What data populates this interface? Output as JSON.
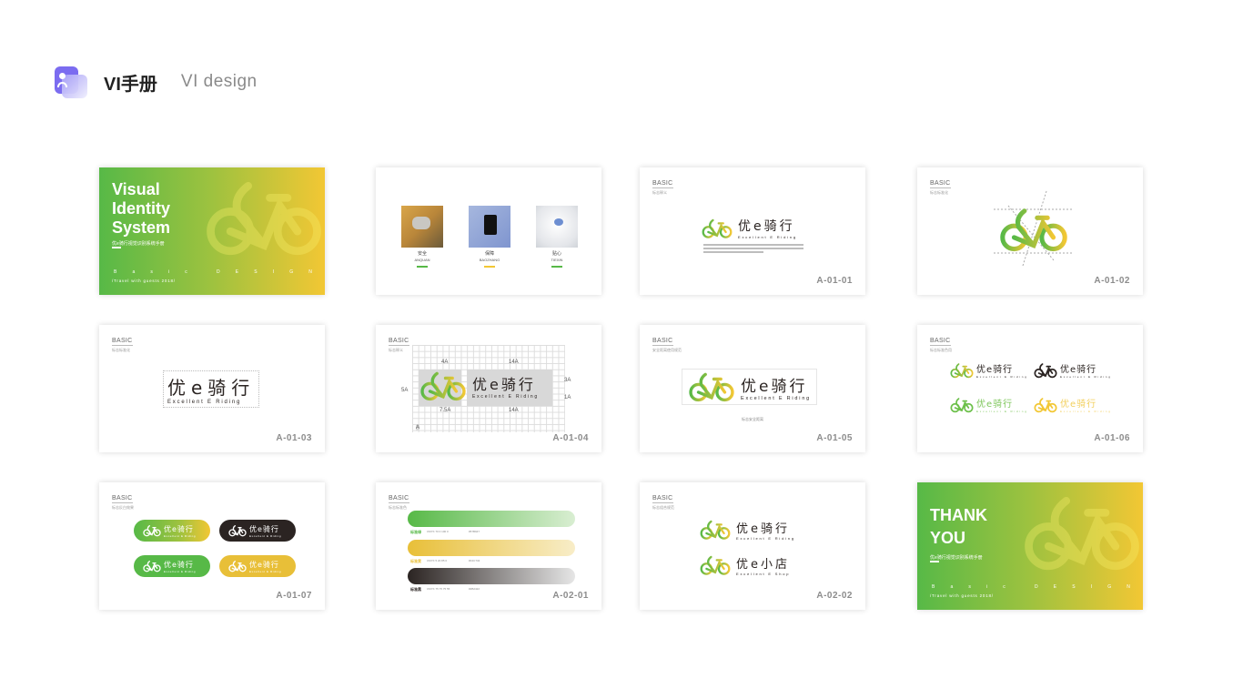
{
  "header": {
    "title": "VI手册",
    "subtitle": "VI design"
  },
  "brand": {
    "name_cn": "优e骑行",
    "name_en": "Excellent E Riding",
    "shop_cn": "优e小店",
    "shop_en": "Excellent E Shop",
    "colors": {
      "green": "#57b947",
      "yellow": "#f2c734",
      "dark": "#2b2422",
      "light_green": "#7dc65a",
      "light_yellow": "#f2cf5c"
    }
  },
  "cards": {
    "cover": {
      "title_lines": [
        "Visual",
        "Identity",
        "System"
      ],
      "subtitle_cn": "优e骑行视觉识别系统手册",
      "basic_letters": [
        "B",
        "a",
        "s",
        "i",
        "c",
        "",
        "D",
        "E",
        "S",
        "I",
        "G",
        "N"
      ],
      "travel": "/Travel with guests 2018/"
    },
    "values": {
      "items": [
        {
          "cn": "安全",
          "en": "ANQUAN",
          "bar_color": "#57b947"
        },
        {
          "cn": "保障",
          "en": "BAOZHANG",
          "bar_color": "#f2c734"
        },
        {
          "cn": "贴心",
          "en": "TIEXIN",
          "bar_color": "#57b947"
        }
      ]
    },
    "a0101": {
      "basic": "BASIC",
      "sub": "标志释义",
      "code": "A-01-01"
    },
    "a0102": {
      "basic": "BASIC",
      "sub": "标志标准化",
      "code": "A-01-02"
    },
    "a0103": {
      "basic": "BASIC",
      "sub": "标志标准化",
      "code": "A-01-03"
    },
    "a0104": {
      "basic": "BASIC",
      "sub": "标志释义",
      "code": "A-01-04",
      "labels": {
        "top_left": "4A",
        "top_right": "14A",
        "left": "5A",
        "right_top": "3A",
        "right_bottom": "1A",
        "bottom_left": "7.5A",
        "bottom_right": "14A",
        "corner": "A"
      }
    },
    "a0105": {
      "basic": "BASIC",
      "sub": "安全距离使用规范",
      "code": "A-01-05",
      "caption": "标志安全距离"
    },
    "a0106": {
      "basic": "BASIC",
      "sub": "标志标准色用",
      "code": "A-01-06"
    },
    "a0107": {
      "basic": "BASIC",
      "sub": "标志反白效果",
      "code": "A-01-07"
    },
    "a0201": {
      "basic": "BASIC",
      "sub": "标志标准色",
      "code": "A-02-01",
      "swatches": [
        {
          "name": "标准绿",
          "meta": "CMYK 70 0 100 0",
          "hex": "#57B947",
          "color": "#57b947"
        },
        {
          "name": "标准黄",
          "meta": "CMYK 5 20 85 0",
          "hex": "#F2C734",
          "color": "#e8bf38"
        },
        {
          "name": "标准黑",
          "meta": "CMYK 75 75 75 55",
          "hex": "#2B2422",
          "color": "#2b2422"
        }
      ]
    },
    "a0202": {
      "basic": "BASIC",
      "sub": "标志组合规范",
      "code": "A-02-02"
    },
    "thanks": {
      "title_lines": [
        "THANK",
        "YOU"
      ],
      "subtitle_cn": "优e骑行视觉识别系统手册",
      "basic_letters": [
        "B",
        "a",
        "s",
        "i",
        "c",
        "",
        "D",
        "E",
        "S",
        "I",
        "G",
        "N"
      ],
      "travel": "/Travel with guests 2018/"
    }
  }
}
